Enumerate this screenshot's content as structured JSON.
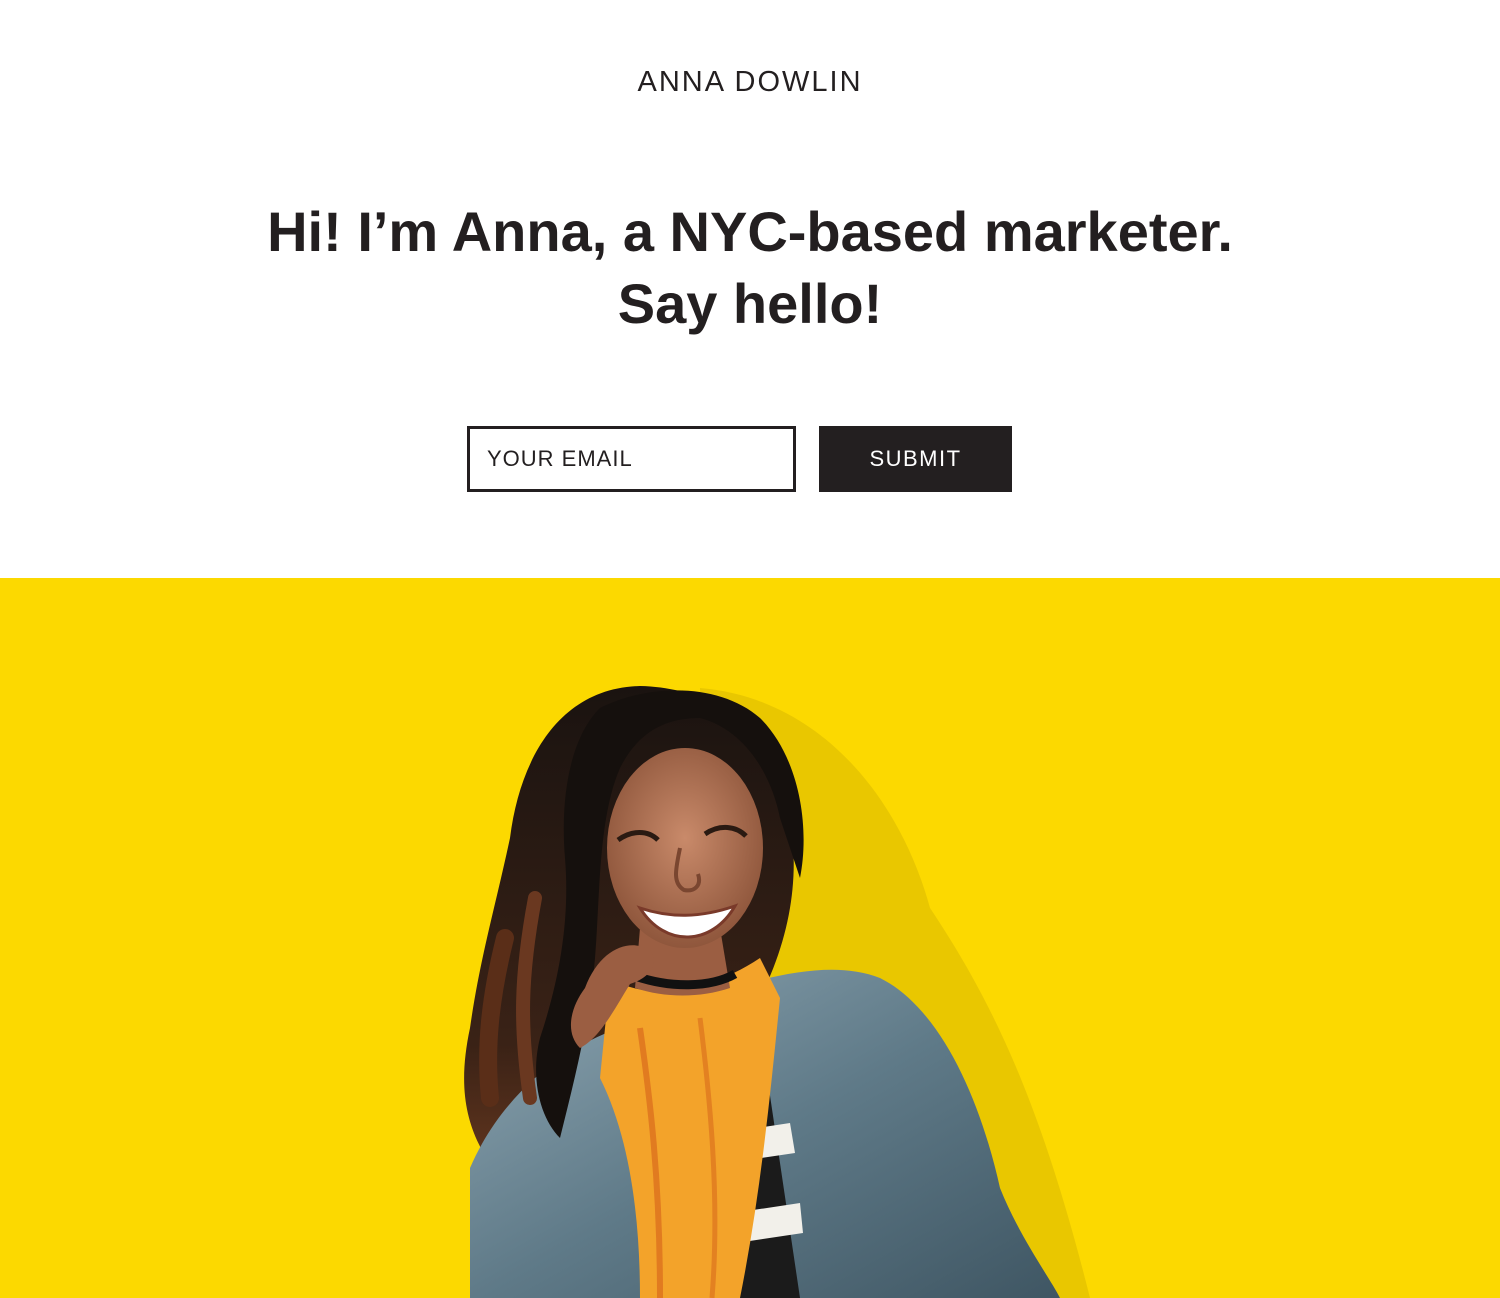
{
  "header": {
    "brand_name": "ANNA DOWLIN"
  },
  "intro": {
    "headline_line1": "Hi! I’m Anna, a NYC-based marketer.",
    "headline_line2": "Say hello!"
  },
  "signup": {
    "email_placeholder": "YOUR EMAIL",
    "submit_label": "SUBMIT"
  },
  "hero": {
    "background_color": "#fcd900",
    "image": "photo of a smiling woman with curly hair wearing a denim jacket and yellow scarf"
  },
  "colors": {
    "text": "#231f20",
    "button_bg": "#231f20",
    "button_text": "#ffffff"
  }
}
